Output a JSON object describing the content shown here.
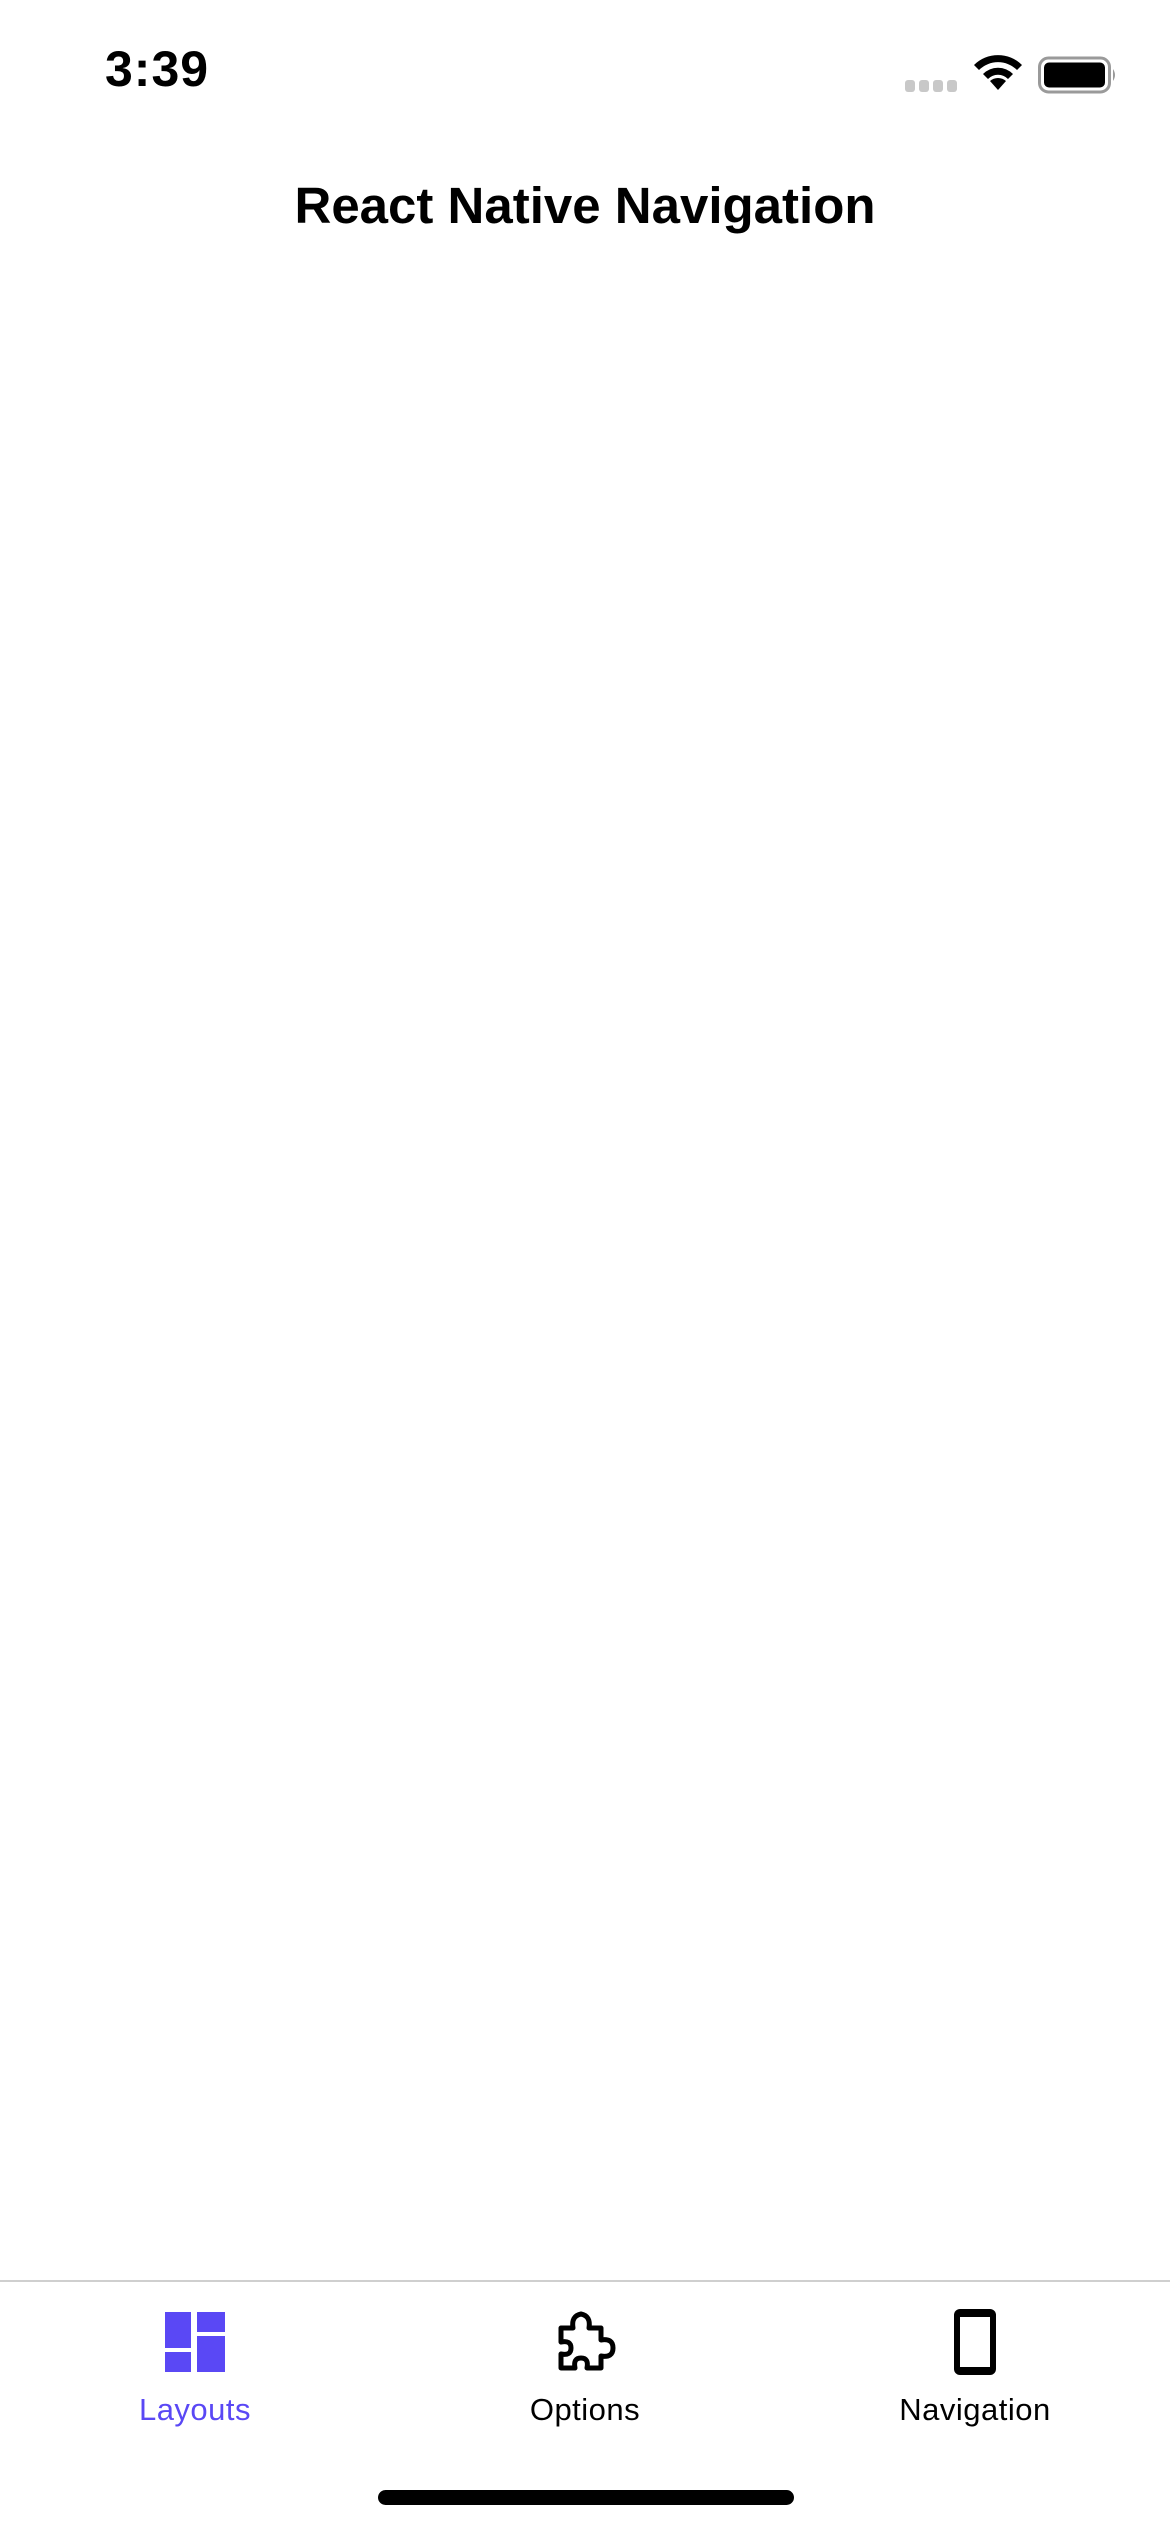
{
  "status_bar": {
    "time": "3:39"
  },
  "header": {
    "title": "React Native Navigation"
  },
  "tab_bar": {
    "items": [
      {
        "label": "Layouts",
        "icon": "layouts-icon",
        "selected": true
      },
      {
        "label": "Options",
        "icon": "puzzle-icon",
        "selected": false
      },
      {
        "label": "Navigation",
        "icon": "phone-icon",
        "selected": false
      }
    ]
  },
  "colors": {
    "accent": "#5a48f5",
    "inactive": "#000000",
    "background": "#ffffff"
  }
}
